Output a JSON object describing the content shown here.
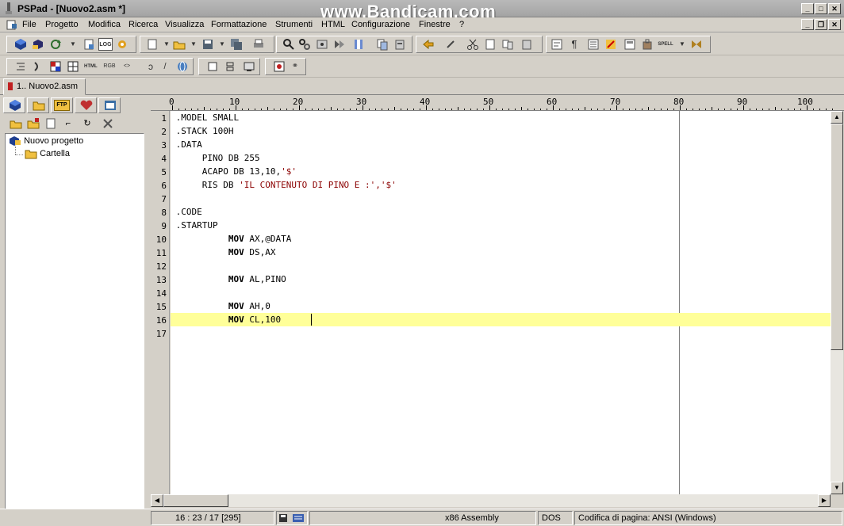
{
  "window": {
    "title": "PSPad - [Nuovo2.asm *]",
    "watermark": "www.Bandicam.com",
    "controls": {
      "minimize": "_",
      "maximize": "□",
      "close": "✕"
    }
  },
  "menu": {
    "items": [
      "File",
      "Progetto",
      "Modifica",
      "Ricerca",
      "Visualizza",
      "Formattazione",
      "Strumenti",
      "HTML",
      "Configurazione",
      "Finestre",
      "?"
    ],
    "mdi_controls": {
      "minimize": "_",
      "restore": "❐",
      "close": "✕"
    }
  },
  "toolbar": {
    "row1_icons": [
      "project-icon",
      "open-project-icon",
      "refresh-icon",
      "new-file-icon",
      "log-icon",
      "settings-icon",
      "new-icon",
      "open-icon",
      "save-icon",
      "save-all-icon",
      "print-icon",
      "find-icon",
      "replace-icon",
      "find-next-icon",
      "find-in-files-icon",
      "bookmark-icon",
      "copy-icon",
      "paste-icon",
      "undo-icon",
      "redo-icon",
      "cut-icon",
      "clipboard-icon",
      "word-wrap-icon",
      "pilcrow-icon",
      "list-icon",
      "tools-icon",
      "spell-icon",
      "compile-icon"
    ],
    "row2_icons": [
      "indent-icon",
      "unindent-icon",
      "table-icon",
      "table2-icon",
      "html-icon",
      "color-icon",
      "tag-icon",
      "check-icon",
      "web-icon",
      "block-icon",
      "snippet-icon",
      "preview-icon",
      "record-icon",
      "macro-icon"
    ],
    "log_label": "LOG",
    "spell_label": "SPELL",
    "ftp_label": "FTP"
  },
  "tabs": {
    "documents": [
      {
        "label": "1.. Nuovo2.asm",
        "active": true
      }
    ]
  },
  "project_panel": {
    "tree": [
      {
        "label": "Nuovo progetto",
        "icon": "project-icon",
        "level": 0
      },
      {
        "label": "Cartella",
        "icon": "folder-icon",
        "level": 1
      }
    ]
  },
  "ruler": {
    "labels": [
      "0",
      "10",
      "20",
      "30",
      "40",
      "50",
      "60",
      "70",
      "80",
      "90",
      "100"
    ]
  },
  "editor": {
    "current_line": 16,
    "right_margin_column": 80,
    "lines": [
      {
        "n": "1",
        "indent": "",
        "kw": "",
        "text": ".MODEL SMALL",
        "str": "",
        "tail": ""
      },
      {
        "n": "2",
        "indent": "",
        "kw": "",
        "text": ".STACK 100H",
        "str": "",
        "tail": ""
      },
      {
        "n": "3",
        "indent": "",
        "kw": "",
        "text": ".DATA",
        "str": "",
        "tail": ""
      },
      {
        "n": "4",
        "indent": "     ",
        "kw": "",
        "text": "PINO DB 255",
        "str": "",
        "tail": ""
      },
      {
        "n": "5",
        "indent": "     ",
        "kw": "",
        "text": "ACAPO DB 13,10,",
        "str": "'$'",
        "tail": ""
      },
      {
        "n": "6",
        "indent": "     ",
        "kw": "",
        "text": "RIS DB ",
        "str": "'IL CONTENUTO DI PINO E :'",
        "tail": ",'$'"
      },
      {
        "n": "7",
        "indent": "",
        "kw": "",
        "text": "",
        "str": "",
        "tail": ""
      },
      {
        "n": "8",
        "indent": "",
        "kw": "",
        "text": ".CODE",
        "str": "",
        "tail": ""
      },
      {
        "n": "9",
        "indent": "",
        "kw": "",
        "text": ".STARTUP",
        "str": "",
        "tail": ""
      },
      {
        "n": "10",
        "indent": "          ",
        "kw": "MOV",
        "text": " AX,@DATA",
        "str": "",
        "tail": ""
      },
      {
        "n": "11",
        "indent": "          ",
        "kw": "MOV",
        "text": " DS,AX",
        "str": "",
        "tail": ""
      },
      {
        "n": "12",
        "indent": "",
        "kw": "",
        "text": "",
        "str": "",
        "tail": ""
      },
      {
        "n": "13",
        "indent": "          ",
        "kw": "MOV",
        "text": " AL,PINO",
        "str": "",
        "tail": ""
      },
      {
        "n": "14",
        "indent": "",
        "kw": "",
        "text": "",
        "str": "",
        "tail": ""
      },
      {
        "n": "15",
        "indent": "          ",
        "kw": "MOV",
        "text": " AH,0",
        "str": "",
        "tail": ""
      },
      {
        "n": "16",
        "indent": "          ",
        "kw": "MOV",
        "text": " CL,100",
        "str": "",
        "tail": ""
      },
      {
        "n": "17",
        "indent": "",
        "kw": "",
        "text": "",
        "str": "",
        "tail": ""
      }
    ]
  },
  "status": {
    "position": "16 : 23 / 17  [295]",
    "syntax": "x86 Assembly",
    "line_endings": "DOS",
    "encoding": "Codifica di pagina: ANSI (Windows)"
  },
  "colors": {
    "current_line": "#ffff99",
    "string": "#8b0000",
    "chrome": "#d4d0c8"
  }
}
